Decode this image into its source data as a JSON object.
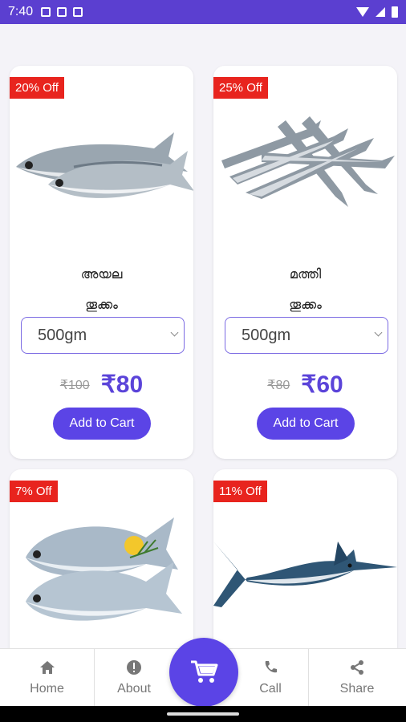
{
  "status_bar": {
    "time": "7:40"
  },
  "products": [
    {
      "badge": "20% Off",
      "name": "അയല",
      "weight_label": "തൂക്കം",
      "weight_option": "500gm",
      "old_price": "₹100",
      "new_price": "₹80",
      "button": "Add to Cart",
      "image_icon": "mackerel-fish-image"
    },
    {
      "badge": "25% Off",
      "name": "മത്തി",
      "weight_label": "തൂക്കം",
      "weight_option": "500gm",
      "old_price": "₹80",
      "new_price": "₹60",
      "button": "Add to Cart",
      "image_icon": "sardine-fish-image"
    },
    {
      "badge": "7% Off",
      "image_icon": "pomfret-fish-image"
    },
    {
      "badge": "11% Off",
      "image_icon": "marlin-fish-image"
    }
  ],
  "bottom_nav": {
    "home": "Home",
    "about": "About",
    "call": "Call",
    "share": "Share"
  },
  "colors": {
    "accent": "#5b44e6",
    "badge": "#e8241e",
    "status_bar": "#5b3fd0"
  }
}
